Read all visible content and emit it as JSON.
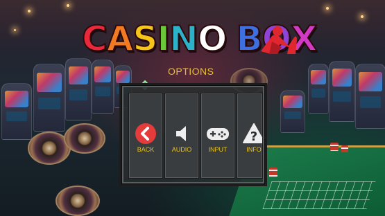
{
  "logo": {
    "text": "CASINO BOX",
    "letter_colors": [
      "#e8293b",
      "#f27a22",
      "#f5c518",
      "#6ac63a",
      "#2ab3c9",
      "#ffffff",
      "#3d6fe0",
      "#8e44d6",
      "#d13ac4"
    ]
  },
  "menu": {
    "title": "OPTIONS",
    "buttons": [
      {
        "label": "BACK",
        "icon": "back-arrow-icon"
      },
      {
        "label": "AUDIO",
        "icon": "speaker-icon"
      },
      {
        "label": "INPUT",
        "icon": "gamepad-icon"
      },
      {
        "label": "INFO",
        "icon": "info-warning-icon"
      }
    ]
  },
  "colors": {
    "label_yellow": "#e7c31e",
    "cursor_green": "#4fd36a",
    "back_red": "#e53b3b",
    "mascot_red": "#e0262e"
  }
}
